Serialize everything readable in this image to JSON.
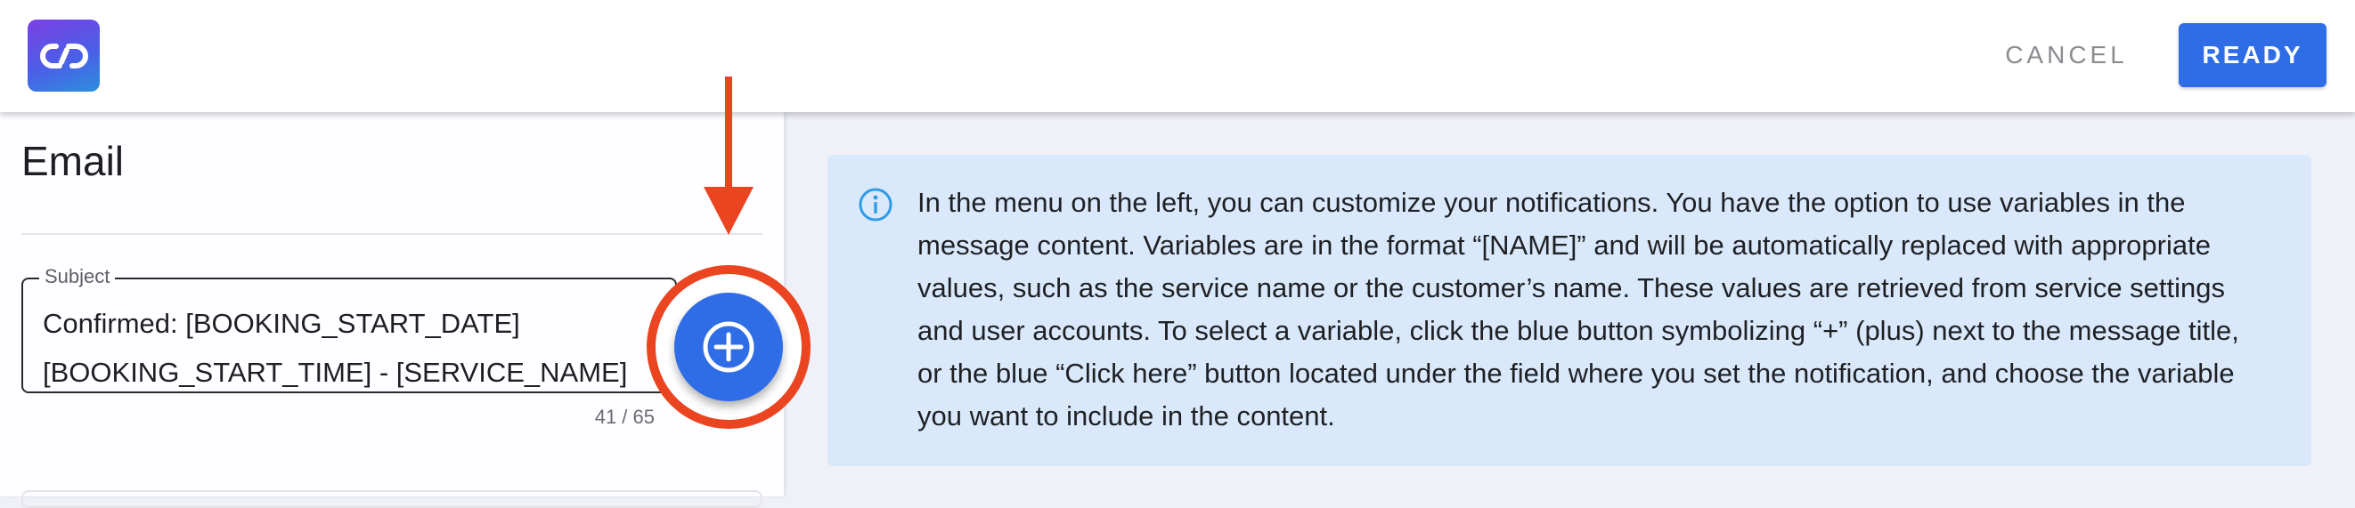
{
  "header": {
    "logo_icon": "link-icon",
    "cancel_label": "CANCEL",
    "ready_label": "READY"
  },
  "panel": {
    "title": "Email",
    "subject": {
      "label": "Subject",
      "value": "Confirmed: [BOOKING_START_DATE] [BOOKING_START_TIME] - [SERVICE_NAME]",
      "counter": "41 / 65"
    },
    "add_variable_icon": "plus-circle-icon"
  },
  "info": {
    "icon": "info-icon",
    "text": "In the menu on the left, you can customize your notifications. You have the option to use variables in the message content. Variables are in the format “[NAME]” and will be automatically replaced with appropriate values, such as the service name or the customer’s name. These values are retrieved from service settings and user accounts. To select a variable, click the blue button symbolizing “+” (plus) next to the message title, or the blue “Click here” button located under the field where you set the notification, and choose the variable you want to include in the content."
  },
  "colors": {
    "accent": "#2f6de6",
    "highlight": "#ea4421",
    "info_background": "#d9e9fb",
    "info_icon": "#2e9be6"
  }
}
